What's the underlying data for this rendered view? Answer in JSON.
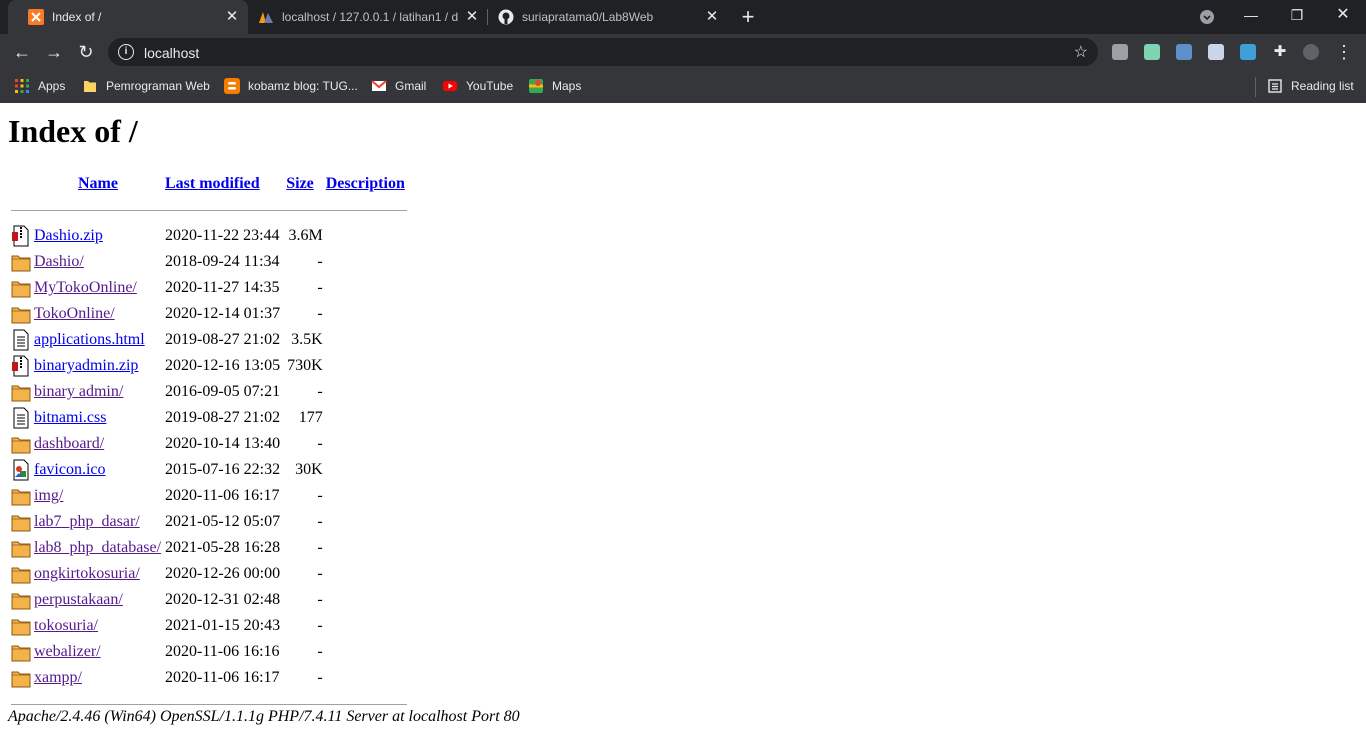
{
  "tabs": [
    {
      "title": "Index of /",
      "active": true,
      "icon": "xampp-icon"
    },
    {
      "title": "localhost / 127.0.0.1 / latihan1 / d",
      "active": false,
      "icon": "phpmyadmin-icon"
    },
    {
      "title": "suriapratama0/Lab8Web",
      "active": false,
      "icon": "github-icon"
    }
  ],
  "toolbar": {
    "url": "localhost"
  },
  "bookmarks": [
    {
      "label": "Apps",
      "icon": "apps-grid-icon"
    },
    {
      "label": "Pemrograman Web",
      "icon": "folder-icon"
    },
    {
      "label": "kobamz blog: TUG...",
      "icon": "blogger-icon"
    },
    {
      "label": "Gmail",
      "icon": "gmail-icon"
    },
    {
      "label": "YouTube",
      "icon": "youtube-icon"
    },
    {
      "label": "Maps",
      "icon": "maps-icon"
    }
  ],
  "reading_list": "Reading list",
  "page": {
    "title": "Index of /",
    "columns": {
      "name": "Name",
      "modified": "Last modified",
      "size": "Size",
      "description": "Description"
    },
    "entries": [
      {
        "name": "Dashio.zip",
        "modified": "2020-11-22 23:44",
        "size": "3.6M",
        "type": "zip"
      },
      {
        "name": "Dashio/",
        "modified": "2018-09-24 11:34",
        "size": "-",
        "type": "folder"
      },
      {
        "name": "MyTokoOnline/",
        "modified": "2020-11-27 14:35",
        "size": "-",
        "type": "folder"
      },
      {
        "name": "TokoOnline/",
        "modified": "2020-12-14 01:37",
        "size": "-",
        "type": "folder"
      },
      {
        "name": "applications.html",
        "modified": "2019-08-27 21:02",
        "size": "3.5K",
        "type": "text"
      },
      {
        "name": "binaryadmin.zip",
        "modified": "2020-12-16 13:05",
        "size": "730K",
        "type": "zip"
      },
      {
        "name": "binary admin/",
        "modified": "2016-09-05 07:21",
        "size": "-",
        "type": "folder"
      },
      {
        "name": "bitnami.css",
        "modified": "2019-08-27 21:02",
        "size": "177",
        "type": "text"
      },
      {
        "name": "dashboard/",
        "modified": "2020-10-14 13:40",
        "size": "-",
        "type": "folder"
      },
      {
        "name": "favicon.ico",
        "modified": "2015-07-16 22:32",
        "size": "30K",
        "type": "image"
      },
      {
        "name": "img/",
        "modified": "2020-11-06 16:17",
        "size": "-",
        "type": "folder"
      },
      {
        "name": "lab7_php_dasar/",
        "modified": "2021-05-12 05:07",
        "size": "-",
        "type": "folder"
      },
      {
        "name": "lab8_php_database/",
        "modified": "2021-05-28 16:28",
        "size": "-",
        "type": "folder"
      },
      {
        "name": "ongkirtokosuria/",
        "modified": "2020-12-26 00:00",
        "size": "-",
        "type": "folder"
      },
      {
        "name": "perpustakaan/",
        "modified": "2020-12-31 02:48",
        "size": "-",
        "type": "folder"
      },
      {
        "name": "tokosuria/",
        "modified": "2021-01-15 20:43",
        "size": "-",
        "type": "folder"
      },
      {
        "name": "webalizer/",
        "modified": "2020-11-06 16:16",
        "size": "-",
        "type": "folder"
      },
      {
        "name": "xampp/",
        "modified": "2020-11-06 16:17",
        "size": "-",
        "type": "folder"
      }
    ],
    "server_signature": "Apache/2.4.46 (Win64) OpenSSL/1.1.1g PHP/7.4.11 Server at localhost Port 80"
  }
}
